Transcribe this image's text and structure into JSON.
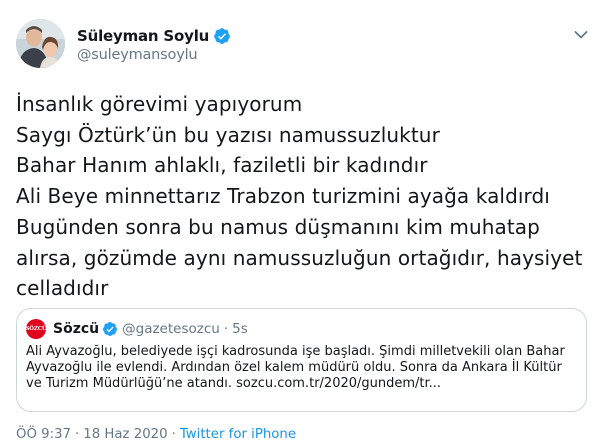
{
  "author": {
    "display_name": "Süleyman Soylu",
    "handle": "@suleymansoylu",
    "verified": true
  },
  "tweet": {
    "lines": [
      "İnsanlık görevimi yapıyorum",
      "Saygı Öztürk’ün bu yazısı namussuzluktur",
      "Bahar Hanım ahlaklı, faziletli bir kadındır",
      "Ali Beye minnettarız Trabzon turizmini ayağa kaldırdı",
      "Bugünden sonra bu namus düşmanını kim muhatap",
      "alırsa, gözümde aynı namussuzluğun ortağıdır, haysiyet",
      "celladıdır"
    ]
  },
  "quoted": {
    "avatar_text": "SÖZCÜ",
    "display_name": "Sözcü",
    "handle": "@gazetesozcu",
    "separator": "·",
    "time": "5s",
    "lines": [
      "Ali Ayvazoğlu, belediyede işçi kadrosunda işe başladı. Şimdi milletvekili olan Bahar",
      "Ayvazoğlu ile evlendi. Ardından özel kalem müdürü oldu. Sonra da Ankara İl Kültür",
      "ve Turizm Müdürlüğü’ne atandı. sozcu.com.tr/2020/gundem/tr..."
    ]
  },
  "footer": {
    "time": "ÖÖ 9:37",
    "separator": "·",
    "date": "18 Haz 2020",
    "source": "Twitter for iPhone"
  },
  "colors": {
    "verified": "#1da1f2",
    "link": "#1b95e0",
    "muted": "#657786",
    "sozcu_red": "#e1001e"
  },
  "icons": {
    "verified": "verified-badge-icon",
    "caret": "chevron-down-icon"
  }
}
